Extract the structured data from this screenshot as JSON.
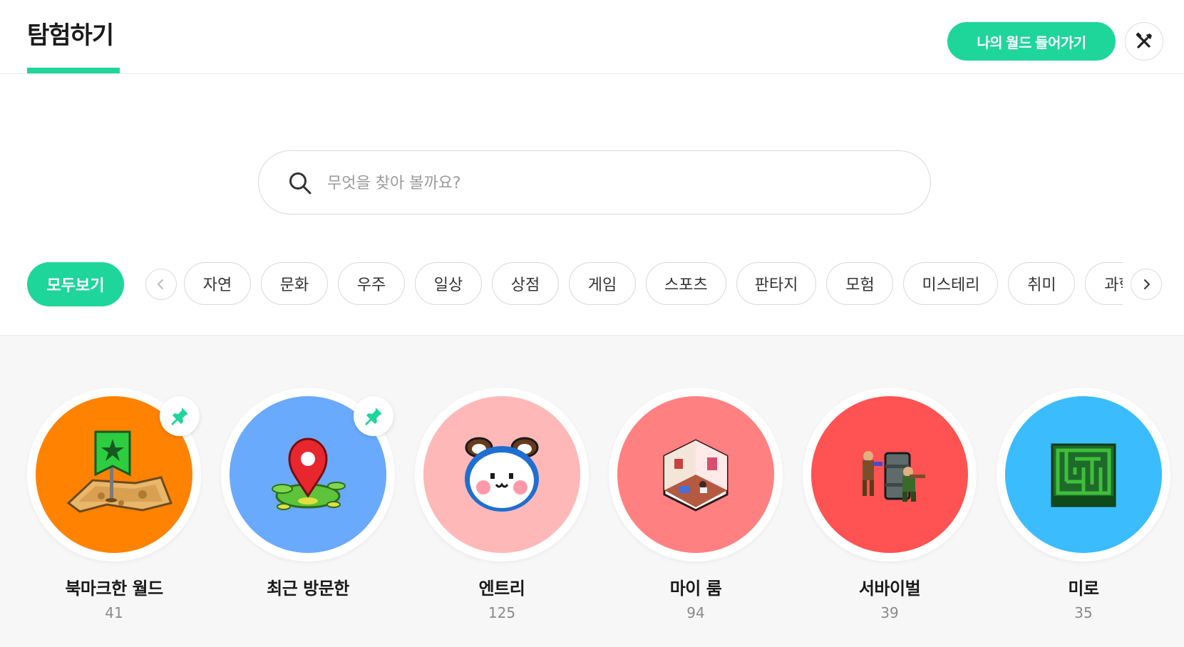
{
  "header": {
    "title": "탐험하기",
    "enter_world_label": "나의 월드 들어가기",
    "tools_icon": "tools-icon"
  },
  "search": {
    "placeholder": "무엇을 찾아 볼까요?",
    "value": ""
  },
  "categories": {
    "all_label": "모두보기",
    "selected": "모두보기",
    "items": [
      "자연",
      "문화",
      "우주",
      "일상",
      "상점",
      "게임",
      "스포츠",
      "판타지",
      "모험",
      "미스테리",
      "취미",
      "과학"
    ]
  },
  "worlds": [
    {
      "name": "북마크한 월드",
      "count": "41",
      "color": "#ff8200",
      "pinned": true,
      "icon": "bookmark-flag-map-icon"
    },
    {
      "name": "최근 방문한",
      "count": "",
      "color": "#6aaafc",
      "pinned": true,
      "icon": "location-pin-island-icon"
    },
    {
      "name": "엔트리",
      "count": "125",
      "color": "#ffb8b8",
      "pinned": false,
      "icon": "entry-mascot-icon"
    },
    {
      "name": "마이 룸",
      "count": "94",
      "color": "#ff8080",
      "pinned": false,
      "icon": "room-cube-icon"
    },
    {
      "name": "서바이벌",
      "count": "39",
      "color": "#ff5252",
      "pinned": false,
      "icon": "soldiers-barrel-icon"
    },
    {
      "name": "미로",
      "count": "35",
      "color": "#3bbcfc",
      "pinned": false,
      "icon": "maze-block-icon"
    }
  ],
  "colors": {
    "accent": "#1ed59a",
    "pin": "#1ed59a"
  }
}
